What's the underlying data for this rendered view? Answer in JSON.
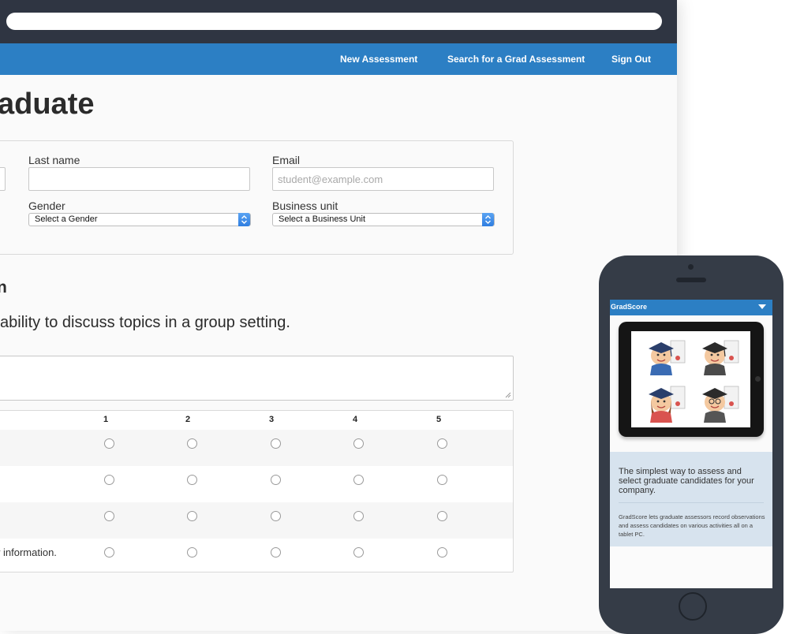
{
  "nav": {
    "links": [
      "New Assessment",
      "Search for a Grad Assessment",
      "Sign Out"
    ]
  },
  "page": {
    "title": "aduate"
  },
  "form": {
    "last_name": {
      "label": "Last name",
      "value": ""
    },
    "email": {
      "label": "Email",
      "placeholder": "student@example.com"
    },
    "gender": {
      "label": "Gender",
      "selected": "Select a Gender"
    },
    "business_unit": {
      "label": "Business unit",
      "selected": "Select a Business Unit"
    }
  },
  "assessment": {
    "section_heading": "n",
    "question": "ability to discuss topics in a group setting.",
    "rating_columns": [
      "1",
      "2",
      "3",
      "4",
      "5"
    ],
    "rows": [
      "",
      "",
      "",
      "w information."
    ]
  },
  "phone": {
    "app_name": "GradScore",
    "headline": "The simplest way to assess and select graduate candidates for your company.",
    "body": "GradScore lets graduate assessors record observations and assess candidates on various activities all on a tablet PC."
  },
  "colors": {
    "chrome": "#2f3542",
    "accent_blue": "#2c7fc4",
    "phone_body": "#353c47",
    "promo_bg": "#d7e3ee"
  }
}
